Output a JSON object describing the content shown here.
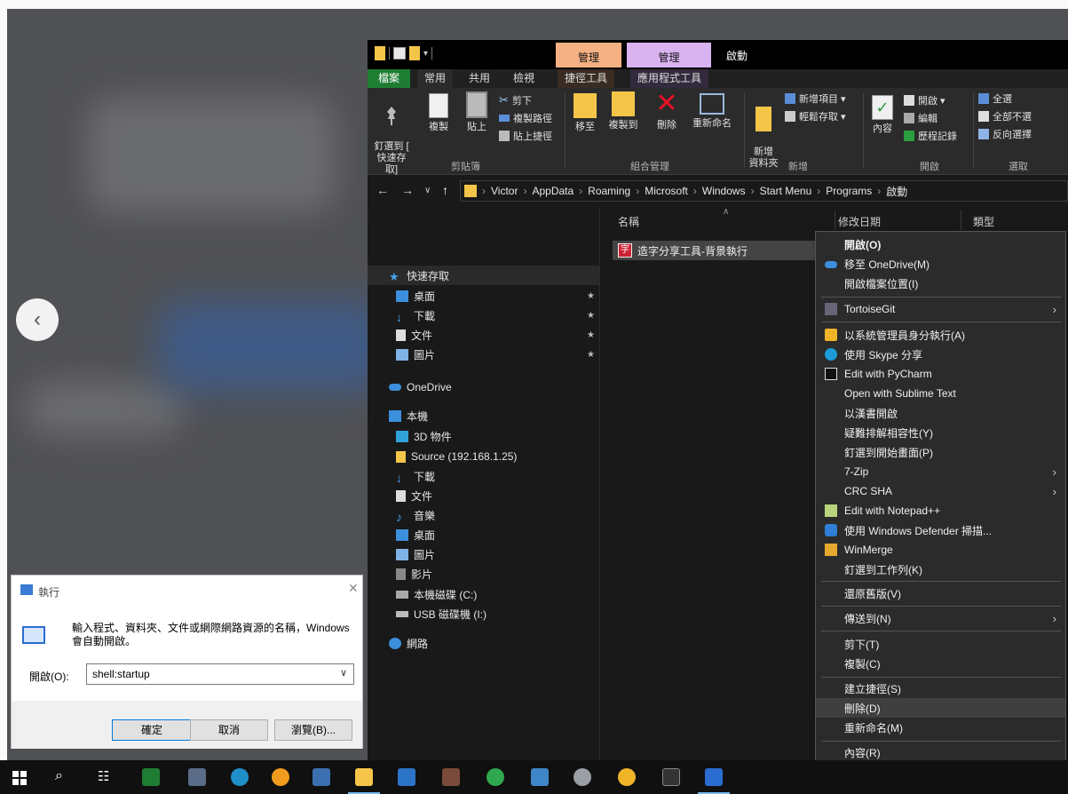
{
  "explorer": {
    "window_title": "啟動",
    "context_tabs": [
      "管理",
      "管理"
    ],
    "ribbon_tabs": {
      "file": "檔案",
      "home": "常用",
      "share": "共用",
      "view": "檢視",
      "shortcut_tools": "捷徑工具",
      "app_tools": "應用程式工具"
    },
    "ribbon": {
      "pin_quick": "釘選到 [\n快速存取]",
      "copy": "複製",
      "paste": "貼上",
      "cut": "剪下",
      "copy_path": "複製路徑",
      "paste_shortcut": "貼上捷徑",
      "group_clipboard": "剪貼簿",
      "move_to": "移至",
      "copy_to": "複製到",
      "delete": "刪除",
      "rename": "重新命名",
      "group_organize": "組合管理",
      "new_folder": "新增\n資料夾",
      "new_item": "新增項目 ▾",
      "easy_access": "輕鬆存取 ▾",
      "group_new": "新增",
      "properties": "內容",
      "open": "開啟 ▾",
      "edit": "編輯",
      "history": "歷程記錄",
      "group_open": "開啟",
      "select_all": "全選",
      "select_none": "全部不選",
      "invert_selection": "反向選擇",
      "group_select": "選取"
    },
    "breadcrumb": [
      "Victor",
      "AppData",
      "Roaming",
      "Microsoft",
      "Windows",
      "Start Menu",
      "Programs",
      "啟動"
    ],
    "nav": {
      "quick_access": "快速存取",
      "desktop": "桌面",
      "downloads": "下載",
      "documents": "文件",
      "pictures": "圖片",
      "onedrive": "OneDrive",
      "this_pc": "本機",
      "objects3d": "3D 物件",
      "source": "Source (192.168.1.25)",
      "downloads2": "下載",
      "documents2": "文件",
      "music": "音樂",
      "desktop2": "桌面",
      "pictures2": "圖片",
      "videos": "影片",
      "local_disk": "本機磁碟 (C:)",
      "usb": "USB 磁碟機 (I:)",
      "network": "網路"
    },
    "columns": {
      "name": "名稱",
      "modified": "修改日期",
      "type": "類型"
    },
    "file": {
      "name": "造字分享工具-背景執行"
    }
  },
  "context_menu": {
    "open": "開啟(O)",
    "move_onedrive": "移至 OneDrive(M)",
    "open_location": "開啟檔案位置(I)",
    "tortoisegit": "TortoiseGit",
    "run_as_admin": "以系統管理員身分執行(A)",
    "skype_share": "使用 Skype 分享",
    "pycharm": "Edit with PyCharm",
    "sublime": "Open with Sublime Text",
    "kanji": "以漢書開啟",
    "troubleshoot": "疑難排解相容性(Y)",
    "pin_start": "釘選到開始畫面(P)",
    "sevenzip": "7-Zip",
    "crcsha": "CRC SHA",
    "notepadpp": "Edit with Notepad++",
    "defender": "使用 Windows Defender 掃描...",
    "winmerge": "WinMerge",
    "pin_taskbar": "釘選到工作列(K)",
    "restore": "還原舊版(V)",
    "send_to": "傳送到(N)",
    "cut": "剪下(T)",
    "copy": "複製(C)",
    "create_shortcut": "建立捷徑(S)",
    "delete": "刪除(D)",
    "rename": "重新命名(M)",
    "properties": "內容(R)"
  },
  "run_dialog": {
    "title": "執行",
    "description": "輸入程式、資料夾、文件或網際網路資源的名稱，Windows 會自動開啟。",
    "open_label": "開啟(O):",
    "input_value": "shell:startup",
    "ok": "確定",
    "cancel": "取消",
    "browse": "瀏覽(B)..."
  },
  "colors": {
    "explorer_bg": "#191919",
    "ribbon_bg": "#2b2b2b",
    "file_tab": "#1e7d33",
    "shortcut_ctx": "#f4b183",
    "app_ctx": "#d9b3f0",
    "taskbar": "#101010"
  }
}
